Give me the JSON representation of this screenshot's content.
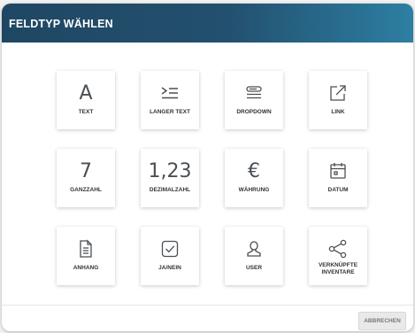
{
  "dialog": {
    "title": "FELDTYP WÄHLEN",
    "cancel_label": "ABBRECHEN"
  },
  "field_types": [
    {
      "label": "TEXT",
      "glyph": "A",
      "icon": "text-letter-icon"
    },
    {
      "label": "LANGER TEXT",
      "icon": "long-text-icon"
    },
    {
      "label": "DROPDOWN",
      "icon": "dropdown-icon"
    },
    {
      "label": "LINK",
      "icon": "external-link-icon"
    },
    {
      "label": "GANZZAHL",
      "glyph": "7",
      "icon": "integer-icon"
    },
    {
      "label": "DEZIMALZAHL",
      "glyph": "1,23",
      "icon": "decimal-icon"
    },
    {
      "label": "WÄHRUNG",
      "glyph": "€",
      "icon": "euro-icon"
    },
    {
      "label": "DATUM",
      "icon": "calendar-icon"
    },
    {
      "label": "ANHANG",
      "icon": "document-icon"
    },
    {
      "label": "JA/NEIN",
      "icon": "checkbox-icon"
    },
    {
      "label": "USER",
      "icon": "user-icon"
    },
    {
      "label": "VERKNÜPFTE INVENTARE",
      "icon": "share-icon"
    }
  ],
  "colors": {
    "header_start": "#1f4763",
    "header_end": "#2d7fa3",
    "icon": "#4a4f54"
  }
}
